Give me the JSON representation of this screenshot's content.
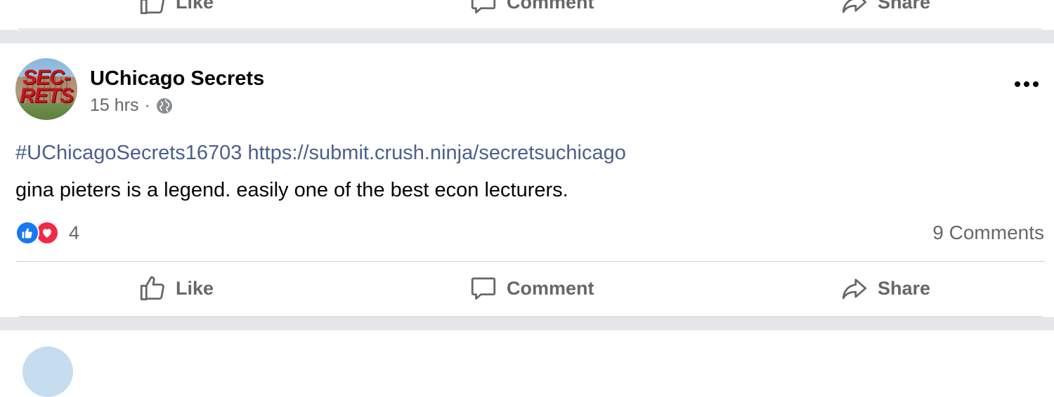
{
  "previous_post": {
    "actions": {
      "like": "Like",
      "comment": "Comment",
      "share": "Share"
    }
  },
  "post": {
    "author": "UChicago Secrets",
    "avatar_text": "SECRETS",
    "avatar_icon": "secrets-logo",
    "time": "15 hrs",
    "separator": "·",
    "privacy_icon": "globe-icon",
    "more_icon": "more-options-icon",
    "hashtag": "#UChicagoSecrets16703",
    "link": "https://submit.crush.ninja/secretsuchicago",
    "body": "gina pieters is a legend. easily one of the best econ lecturers.",
    "reaction_icons": [
      "like-reaction-icon",
      "love-reaction-icon"
    ],
    "reaction_count": "4",
    "comments_count": "9 Comments",
    "actions": {
      "like": "Like",
      "comment": "Comment",
      "share": "Share"
    }
  },
  "colors": {
    "link": "#4b5f8c",
    "secondary_text": "#65676b",
    "like_blue": "#1877f2",
    "love_red": "#f0284a",
    "separator_gray": "#e4e6ea"
  }
}
